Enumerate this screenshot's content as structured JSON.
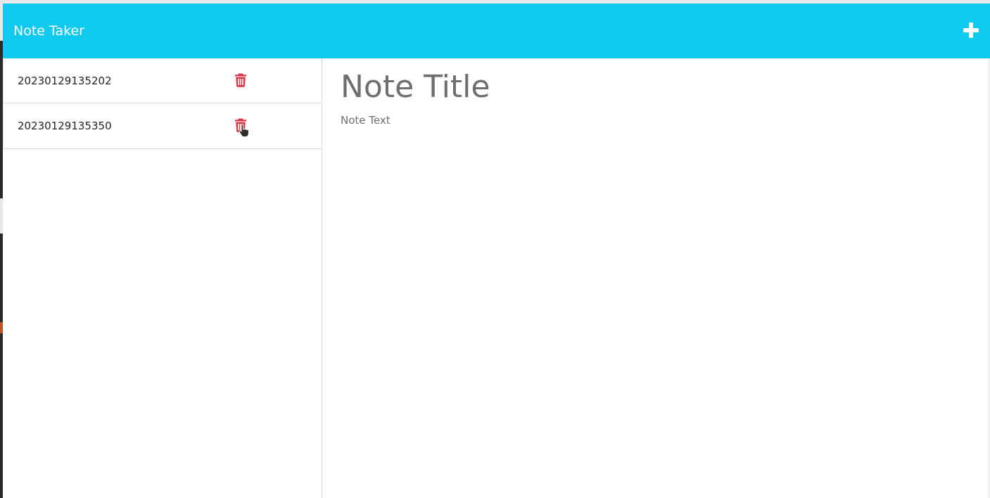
{
  "app": {
    "title": "Note Taker",
    "accent_color": "#0fc9ef",
    "add_icon": "plus-icon"
  },
  "sidebar": {
    "notes": [
      {
        "title": "20230129135202",
        "delete_icon": "trash-icon"
      },
      {
        "title": "20230129135350",
        "delete_icon": "trash-icon"
      }
    ],
    "delete_color": "#dc3545"
  },
  "editor": {
    "title_placeholder": "Note Title",
    "text_placeholder": "Note Text"
  }
}
